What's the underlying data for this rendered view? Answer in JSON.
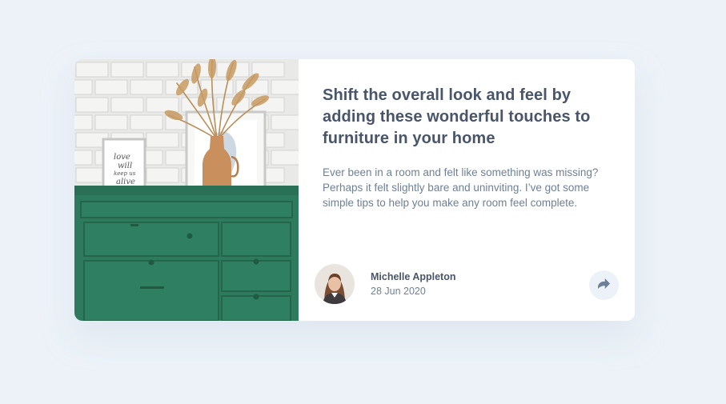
{
  "article": {
    "title": "Shift the overall look and feel by adding these wonderful touches to furniture in your home",
    "description": "Ever been in a room and felt like something was missing? Perhaps it felt slightly bare and uninviting. I’ve got some simple tips to help you make any room feel complete.",
    "image_frame_text": "love will keep us alive"
  },
  "author": {
    "name": "Michelle Appleton",
    "date": "28 Jun 2020"
  },
  "share": {
    "icon": "share-icon"
  },
  "colors": {
    "background": "#ECF2F8",
    "title": "#48556A",
    "body": "#6E8098",
    "dresser": "#2E7A5F",
    "share_button_bg": "#ECF2F8",
    "share_icon": "#6E8098"
  }
}
